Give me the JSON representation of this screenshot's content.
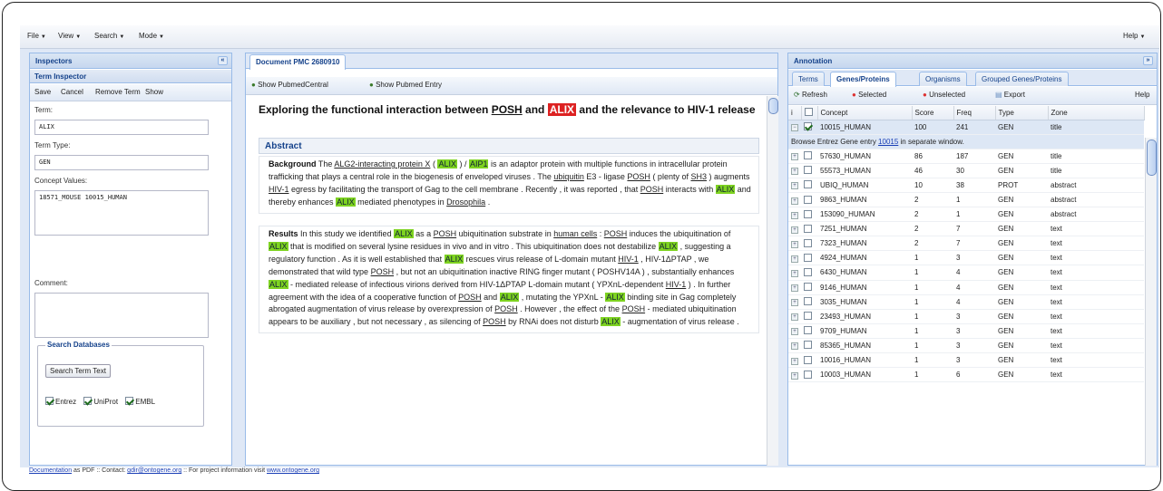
{
  "menu": {
    "items": [
      {
        "label": "File"
      },
      {
        "label": "View"
      },
      {
        "label": "Search"
      },
      {
        "label": "Mode"
      }
    ],
    "help": "Help"
  },
  "inspectors": {
    "title": "Inspectors",
    "term_inspector": "Term Inspector",
    "toolbar": {
      "save": "Save",
      "cancel": "Cancel",
      "remove": "Remove Term",
      "show": "Show"
    },
    "term_label": "Term:",
    "term_value": "ALIX",
    "term_type_label": "Term Type:",
    "term_type_value": "GEN",
    "concept_label": "Concept Values:",
    "concept_value": "18571_MOUSE 10015_HUMAN",
    "comment_label": "Comment:",
    "comment_value": "",
    "search_db": {
      "title": "Search Databases",
      "button": "Search Term Text",
      "options": [
        {
          "label": "Entrez",
          "checked": true
        },
        {
          "label": "UniProt",
          "checked": true
        },
        {
          "label": "EMBL",
          "checked": true
        }
      ]
    }
  },
  "document": {
    "tab": "Document PMC 2680910",
    "toolbar": {
      "show_pmc": "Show PubmedCentral",
      "show_pubmed": "Show Pubmed Entry"
    },
    "title": {
      "t1": "Exploring the functional interaction between ",
      "posh": "POSH",
      "t2": " and ",
      "alix": "ALIX",
      "t3": " and the relevance to HIV-1 release"
    },
    "abstract_heading": "Abstract",
    "background": {
      "label": "Background",
      "s1": " The ",
      "alg2": "ALG2-interacting protein X",
      "s2": " ( ",
      "alix1": "ALIX",
      "s3": " ) / ",
      "aip1": "AIP1",
      "s4": " is an adaptor protein with multiple functions in intracellular protein trafficking that plays a central role in the biogenesis of enveloped viruses . The ",
      "ubiquitin": "ubiquitin",
      "s5": " E3 - ligase ",
      "posh1": "POSH",
      "s6": " ( plenty of ",
      "sh3": "SH3",
      "s7": " ) augments ",
      "hiv1": "HIV-1",
      "s8": " egress by facilitating the transport of Gag to the cell membrane . Recently , it was reported , that ",
      "posh2": "POSH",
      "s9": " interacts with ",
      "alix2": "ALIX",
      "s10": " and thereby enhances ",
      "alix3": "ALIX",
      "s11": " mediated phenotypes in ",
      "dros": "Drosophila",
      "s12": " ."
    },
    "results": {
      "label": "Results",
      "r1": " In this study we identified ",
      "alix1": "ALIX",
      "r2": " as a ",
      "posh1": "POSH",
      "r3": " ubiquitination substrate in ",
      "human": "human cells",
      "r4": " : ",
      "posh2": "POSH",
      "r5": " induces the ubiquitination of ",
      "alix2": "ALIX",
      "r6": " that is modified on several lysine residues in vivo and in vitro . This ubiquitination does not destabilize ",
      "alix3": "ALIX",
      "r7": " , suggesting a regulatory function . As it is well established that ",
      "alix4": "ALIX",
      "r8": " rescues virus release of L-domain mutant ",
      "hiv1a": "HIV-1",
      "r9": " , HIV-1ΔPTAP , we demonstrated that wild type ",
      "posh3": "POSH",
      "r10": " , but not an ubiquitination inactive RING finger mutant ( POSHV14A ) , substantially enhances ",
      "alix5": "ALIX",
      "r11": " - mediated release of infectious virions derived from HIV-1ΔPTAP L-domain mutant ( YPXnL-dependent ",
      "hiv1b": "HIV-1",
      "r12": " ) . In further agreement with the idea of a cooperative function of ",
      "posh4": "POSH",
      "r13": " and ",
      "alix6": "ALIX",
      "r14": " , mutating the YPXnL - ",
      "alix7": "ALIX",
      "r15": " binding site in Gag completely abrogated augmentation of virus release by overexpression of ",
      "posh5": "POSH",
      "r16": " . However , the effect of the ",
      "posh6": "POSH",
      "r17": " - mediated ubiquitination appears to be auxiliary , but not necessary , as silencing of ",
      "posh7": "POSH",
      "r18": " by RNAi does not disturb ",
      "alix8": "ALIX",
      "r19": " - augmentation of virus release ."
    }
  },
  "annotation": {
    "title": "Annotation",
    "tabs": [
      {
        "label": "Terms"
      },
      {
        "label": "Genes/Proteins"
      },
      {
        "label": "Organisms"
      },
      {
        "label": "Grouped Genes/Proteins"
      }
    ],
    "toolbar": {
      "refresh": "Refresh",
      "selected": "Selected",
      "unselected": "Unselected",
      "export": "Export",
      "help": "Help"
    },
    "columns": [
      "i",
      "",
      "Concept",
      "Score",
      "Freq",
      "Type",
      "Zone"
    ],
    "detail": {
      "t1": "Browse Entrez Gene entry ",
      "link": "10015",
      "t2": " in separate window."
    },
    "rows": [
      {
        "concept": "10015_HUMAN",
        "score": "100",
        "freq": "241",
        "type": "GEN",
        "zone": "title",
        "checked": true
      },
      {
        "concept": "57630_HUMAN",
        "score": "86",
        "freq": "187",
        "type": "GEN",
        "zone": "title"
      },
      {
        "concept": "55573_HUMAN",
        "score": "46",
        "freq": "30",
        "type": "GEN",
        "zone": "title"
      },
      {
        "concept": "UBIQ_HUMAN",
        "score": "10",
        "freq": "38",
        "type": "PROT",
        "zone": "abstract"
      },
      {
        "concept": "9863_HUMAN",
        "score": "2",
        "freq": "1",
        "type": "GEN",
        "zone": "abstract"
      },
      {
        "concept": "153090_HUMAN",
        "score": "2",
        "freq": "1",
        "type": "GEN",
        "zone": "abstract"
      },
      {
        "concept": "7251_HUMAN",
        "score": "2",
        "freq": "7",
        "type": "GEN",
        "zone": "text"
      },
      {
        "concept": "7323_HUMAN",
        "score": "2",
        "freq": "7",
        "type": "GEN",
        "zone": "text"
      },
      {
        "concept": "4924_HUMAN",
        "score": "1",
        "freq": "3",
        "type": "GEN",
        "zone": "text"
      },
      {
        "concept": "6430_HUMAN",
        "score": "1",
        "freq": "4",
        "type": "GEN",
        "zone": "text"
      },
      {
        "concept": "9146_HUMAN",
        "score": "1",
        "freq": "4",
        "type": "GEN",
        "zone": "text"
      },
      {
        "concept": "3035_HUMAN",
        "score": "1",
        "freq": "4",
        "type": "GEN",
        "zone": "text"
      },
      {
        "concept": "23493_HUMAN",
        "score": "1",
        "freq": "3",
        "type": "GEN",
        "zone": "text"
      },
      {
        "concept": "9709_HUMAN",
        "score": "1",
        "freq": "3",
        "type": "GEN",
        "zone": "text"
      },
      {
        "concept": "85365_HUMAN",
        "score": "1",
        "freq": "3",
        "type": "GEN",
        "zone": "text"
      },
      {
        "concept": "10016_HUMAN",
        "score": "1",
        "freq": "3",
        "type": "GEN",
        "zone": "text"
      },
      {
        "concept": "10003_HUMAN",
        "score": "1",
        "freq": "6",
        "type": "GEN",
        "zone": "text"
      }
    ]
  },
  "footer": {
    "doc": "Documentation",
    "t1": " as PDF :: Contact: ",
    "email": "gdir@ontogene.org",
    "t2": " :: For project information visit ",
    "site": "www.ontogene.org"
  },
  "colors": {
    "highlight_red": "#dd2222",
    "highlight_green": "#7ed321",
    "panel_header": "#15428b",
    "link": "#1a3fb6"
  }
}
